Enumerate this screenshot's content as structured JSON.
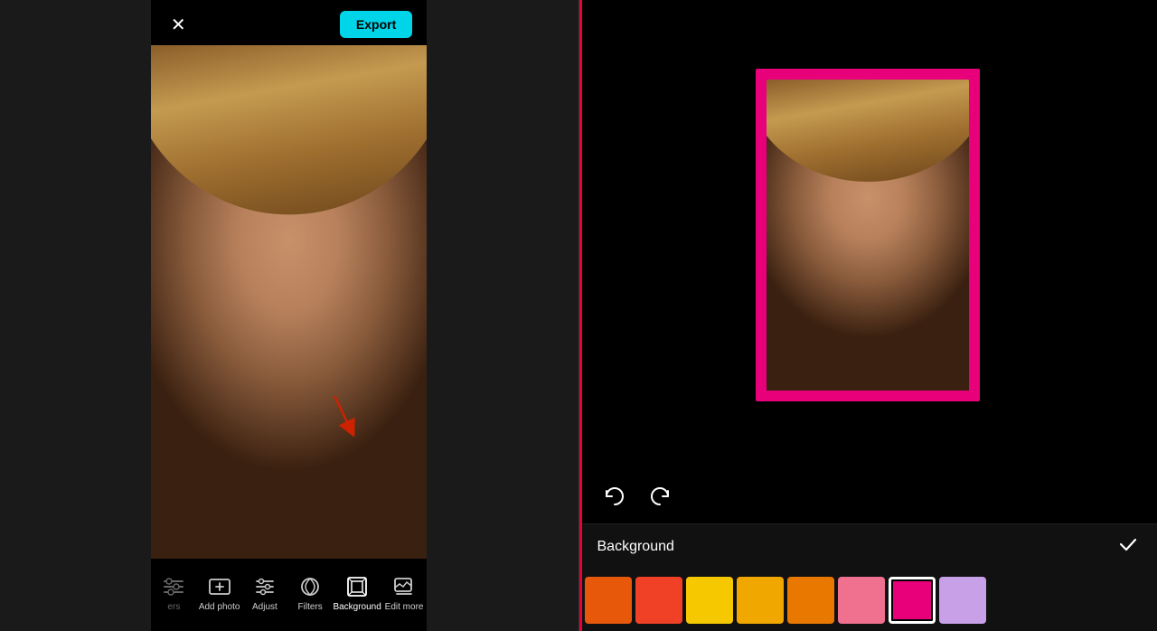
{
  "left": {
    "close_label": "✕",
    "export_label": "Export",
    "toolbar": {
      "items": [
        {
          "id": "filters-partial",
          "label": "ers",
          "partial": true
        },
        {
          "id": "add-photo",
          "label": "Add photo",
          "partial": false
        },
        {
          "id": "adjust",
          "label": "Adjust",
          "partial": false
        },
        {
          "id": "filters",
          "label": "Filters",
          "partial": false
        },
        {
          "id": "background",
          "label": "Background",
          "partial": false,
          "active": true
        },
        {
          "id": "edit-more",
          "label": "Edit more",
          "partial": false
        }
      ]
    }
  },
  "right": {
    "undo_title": "Undo",
    "redo_title": "Redo",
    "background_label": "Background",
    "check_label": "✓",
    "colors": [
      {
        "hex": "#e8580a",
        "selected": false
      },
      {
        "hex": "#f04025",
        "selected": false
      },
      {
        "hex": "#f5c800",
        "selected": false
      },
      {
        "hex": "#f0a800",
        "selected": false
      },
      {
        "hex": "#e87800",
        "selected": false
      },
      {
        "hex": "#f07090",
        "selected": false
      },
      {
        "hex": "#e8007a",
        "selected": true
      },
      {
        "hex": "#c8a0e8",
        "selected": false
      }
    ]
  }
}
